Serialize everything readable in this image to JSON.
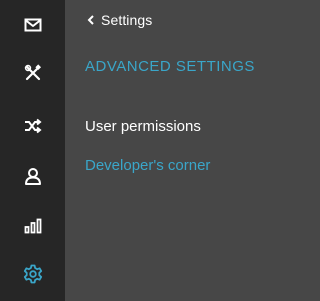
{
  "sidebar": {
    "icons": [
      {
        "name": "mail-icon",
        "active": false
      },
      {
        "name": "tools-icon",
        "active": false
      },
      {
        "name": "shuffle-icon",
        "active": false
      },
      {
        "name": "user-icon",
        "active": false
      },
      {
        "name": "bar-chart-icon",
        "active": false
      },
      {
        "name": "settings-icon",
        "active": true
      }
    ]
  },
  "panel": {
    "back_label": "Settings",
    "items": [
      {
        "label": "ADVANCED SETTINGS"
      },
      {
        "label": "User permissions"
      },
      {
        "label": "Developer's corner"
      }
    ]
  },
  "colors": {
    "rail_bg": "#262626",
    "panel_bg": "#474747",
    "accent": "#3aa6c9",
    "text": "#ffffff"
  }
}
